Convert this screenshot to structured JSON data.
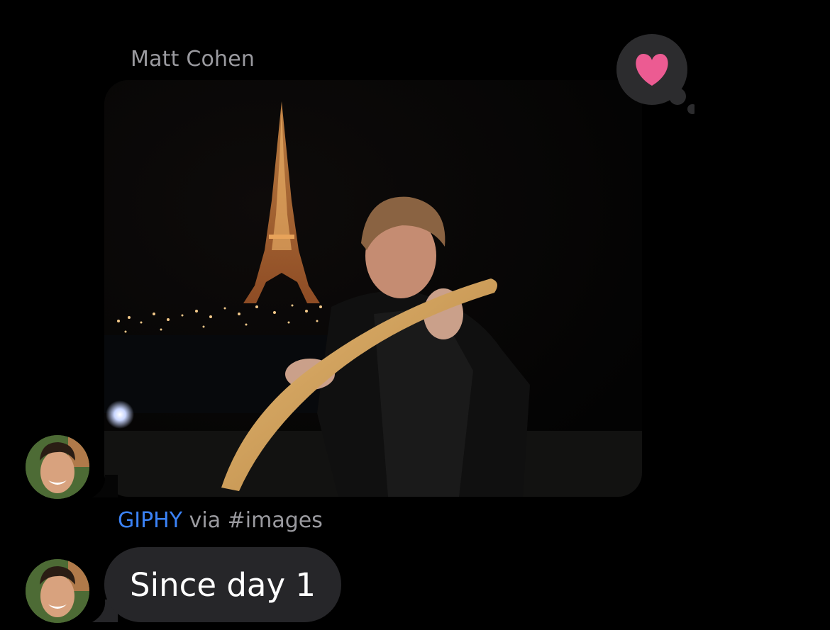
{
  "message": {
    "sender_name": "Matt Cohen"
  },
  "gif": {
    "source_label": "GIPHY",
    "via_text": "via #images"
  },
  "reply": {
    "text": "Since day 1"
  },
  "tapback": {
    "icon": "heart-icon",
    "color": "#ec5b92"
  },
  "colors": {
    "background": "#000000",
    "bubble": "#262629",
    "secondary_text": "#9a9a9f",
    "link": "#3b82f6"
  }
}
